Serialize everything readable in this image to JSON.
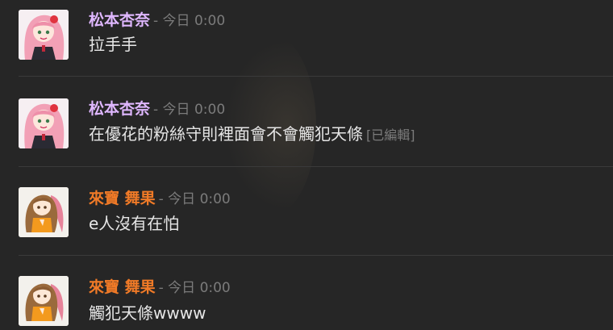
{
  "messages": [
    {
      "author": "松本杏奈",
      "timestamp": "- 今日 0:00",
      "text": "拉手手",
      "edited": "",
      "name_color": "#dfb7ff",
      "avatar_icon": "pink-hair-anime-girl-avatar"
    },
    {
      "author": "松本杏奈",
      "timestamp": "- 今日 0:00",
      "text": "在優花的粉絲守則裡面會不會觸犯天條",
      "edited": "[已編輯]",
      "name_color": "#dfb7ff",
      "avatar_icon": "pink-hair-anime-girl-avatar"
    },
    {
      "author": "來寶 舞果",
      "timestamp": "- 今日 0:00",
      "text": "e人沒有在怕",
      "edited": "",
      "name_color": "#f07a27",
      "avatar_icon": "brown-hair-anime-girl-avatar"
    },
    {
      "author": "來寶 舞果",
      "timestamp": "- 今日 0:00",
      "text": "觸犯天條wwww",
      "edited": "",
      "name_color": "#f07a27",
      "avatar_icon": "brown-hair-anime-girl-avatar"
    }
  ],
  "colors": {
    "background": "#262626",
    "text": "#e6e6e6",
    "muted": "#7b7b7b"
  }
}
